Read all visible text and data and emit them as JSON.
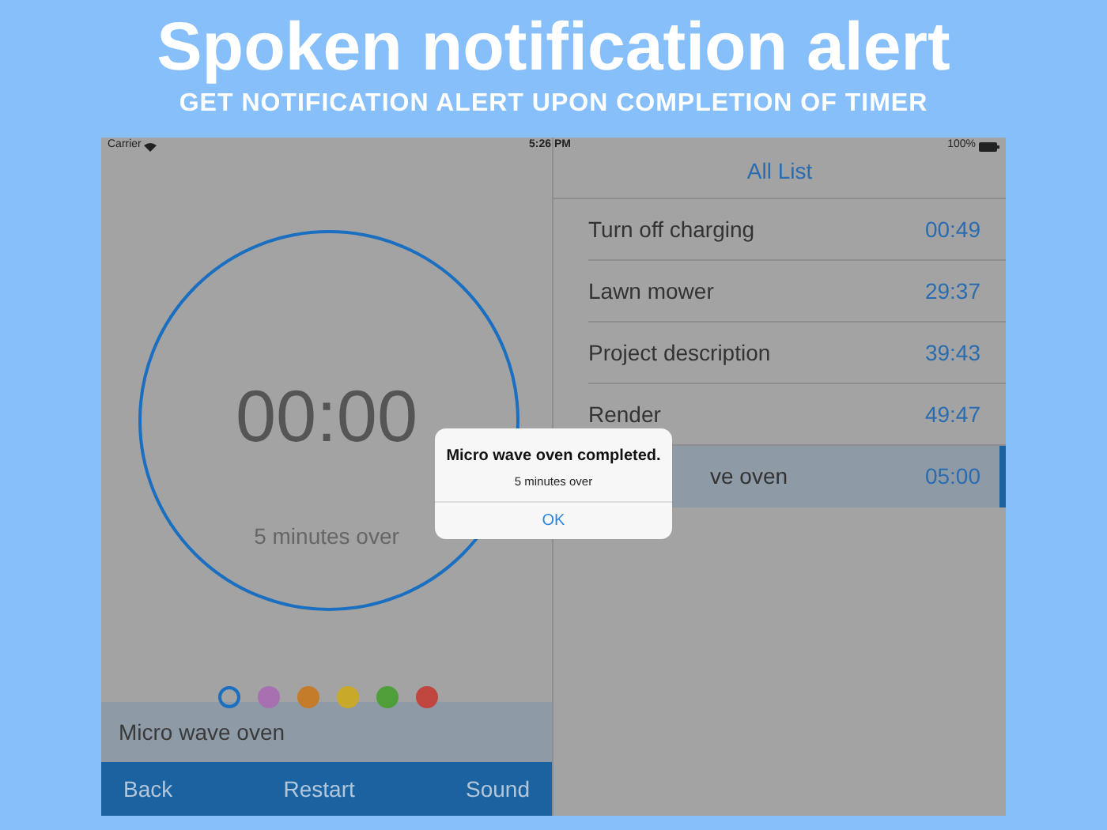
{
  "headline": {
    "title": "Spoken notification alert",
    "subtitle": "GET NOTIFICATION ALERT UPON COMPLETION OF TIMER"
  },
  "status_bar": {
    "carrier": "Carrier",
    "time": "5:26 PM",
    "battery": "100%"
  },
  "timer": {
    "time": "00:00",
    "caption": "5 minutes over"
  },
  "colors": [
    {
      "color": "#1a6fc0",
      "selected": true
    },
    {
      "color": "#a770b0",
      "selected": false
    },
    {
      "color": "#c47c2a",
      "selected": false
    },
    {
      "color": "#c9a92a",
      "selected": false
    },
    {
      "color": "#4e9e3a",
      "selected": false
    },
    {
      "color": "#c0473f",
      "selected": false
    }
  ],
  "name_field": {
    "value": "Micro wave oven"
  },
  "toolbar": [
    "Back",
    "Restart",
    "Sound"
  ],
  "list": {
    "title": "All List",
    "items": [
      {
        "name": "Turn off charging",
        "time": "00:49",
        "selected": false
      },
      {
        "name": "Lawn mower",
        "time": "29:37",
        "selected": false
      },
      {
        "name": "Project description",
        "time": "39:43",
        "selected": false
      },
      {
        "name": "Render",
        "time": "49:47",
        "selected": false
      },
      {
        "name": "ve oven",
        "time": "05:00",
        "selected": true
      }
    ]
  },
  "alert": {
    "title": "Micro wave oven completed.",
    "message": "5 minutes over",
    "button": "OK"
  }
}
